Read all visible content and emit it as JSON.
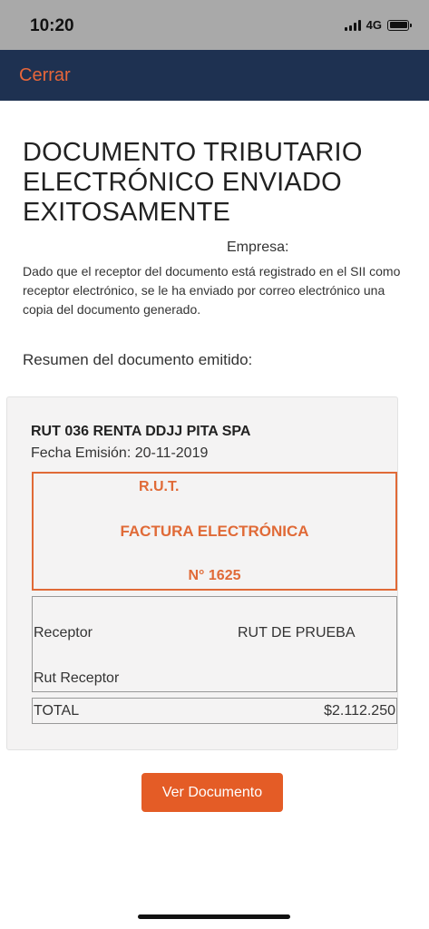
{
  "status_bar": {
    "time": "10:20",
    "network": "4G",
    "icons": [
      "signal-icon",
      "battery-icon"
    ]
  },
  "nav": {
    "close_label": "Cerrar"
  },
  "header": {
    "title": "DOCUMENTO TRIBUTARIO ELECTRÓNICO ENVIADO EXITOSAMENTE",
    "company_label": "Empresa:",
    "description": "Dado que el receptor del documento está registrado en el SII como receptor electrónico, se le ha enviado por correo electrónico una copia del documento generado."
  },
  "summary": {
    "title": "Resumen del documento emitido:",
    "company_name": "RUT 036 RENTA DDJJ PITA SPA",
    "issue_date": "Fecha Emisión: 20-11-2019",
    "document": {
      "rut_label": "R.U.T.",
      "type": "FACTURA ELECTRÓNICA",
      "number": "N° 1625"
    },
    "receptor": {
      "label": "Receptor",
      "value": "RUT DE PRUEBA",
      "rut_label": "Rut Receptor",
      "rut_value": ""
    },
    "total": {
      "label": "TOTAL",
      "value": "$2.112.250"
    }
  },
  "actions": {
    "view_document_label": "Ver Documento"
  },
  "colors": {
    "nav_background": "#1e3151",
    "accent": "#e45c26",
    "document_border": "#e06a37",
    "status_bar": "#a9a9a9"
  }
}
